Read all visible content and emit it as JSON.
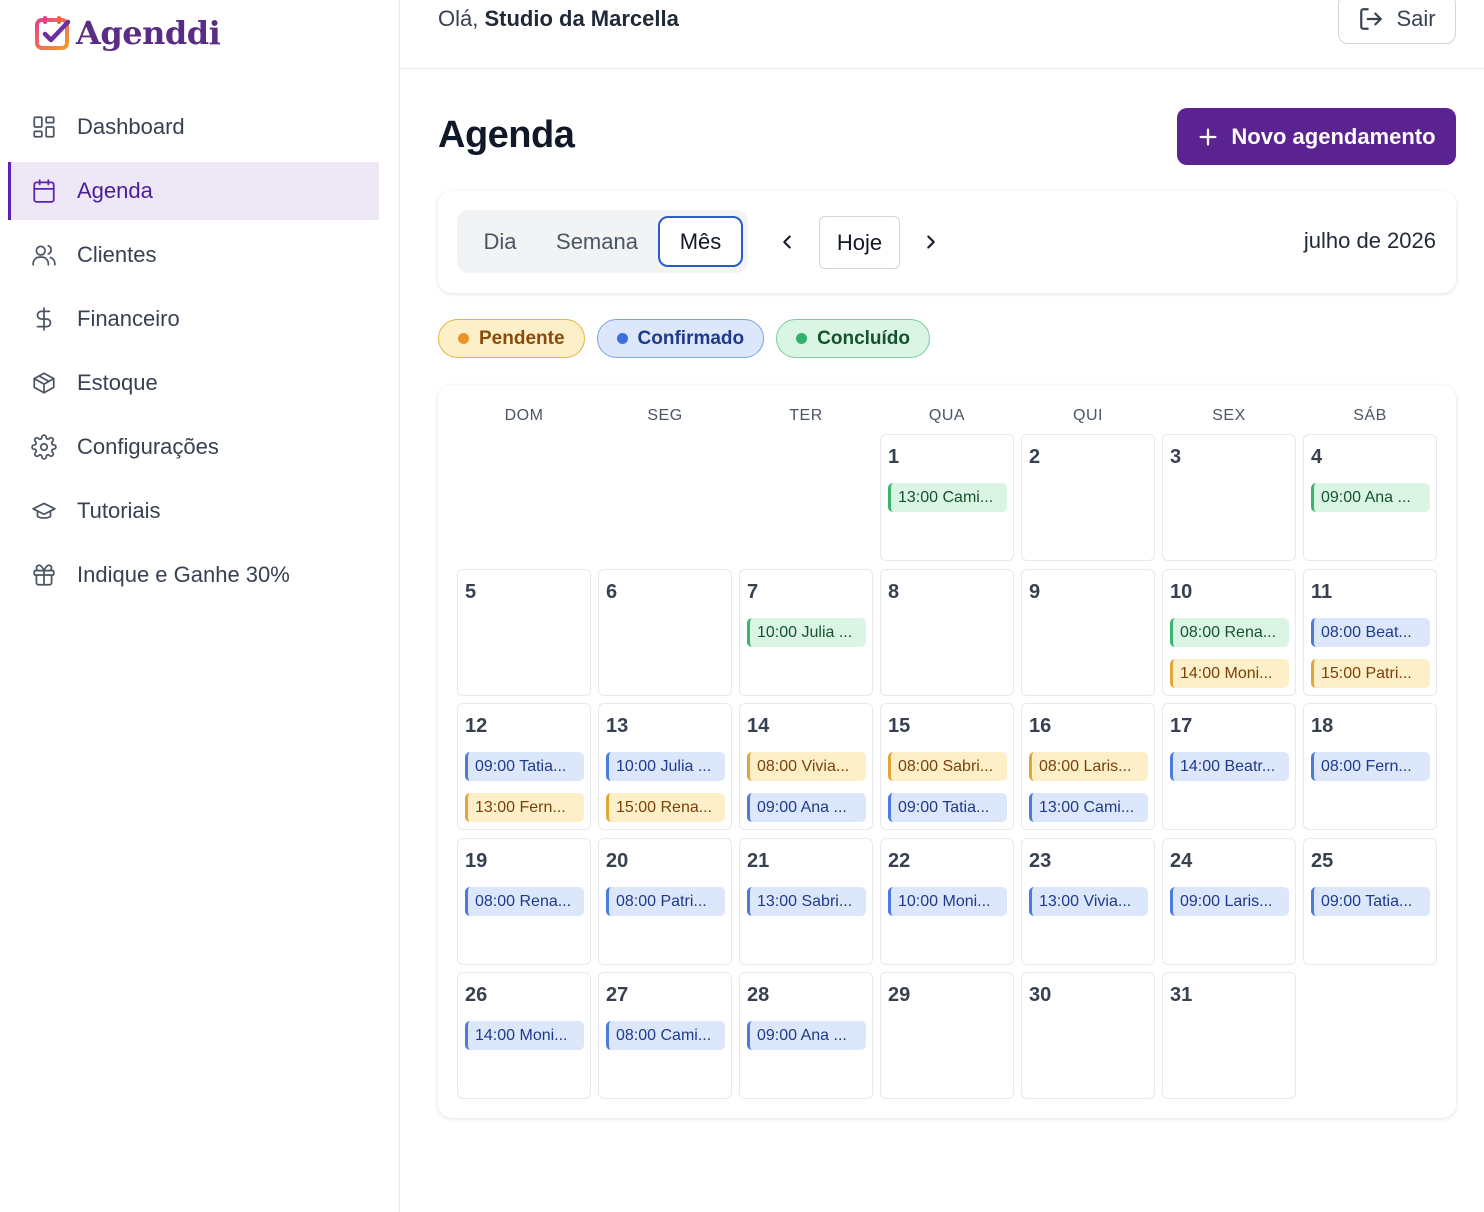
{
  "brand": {
    "name": "Agenddi"
  },
  "sidebar": {
    "items": [
      {
        "label": "Dashboard",
        "icon": "dashboard-icon",
        "active": false
      },
      {
        "label": "Agenda",
        "icon": "calendar-icon",
        "active": true
      },
      {
        "label": "Clientes",
        "icon": "users-icon",
        "active": false
      },
      {
        "label": "Financeiro",
        "icon": "dollar-icon",
        "active": false
      },
      {
        "label": "Estoque",
        "icon": "box-icon",
        "active": false
      },
      {
        "label": "Configurações",
        "icon": "gear-icon",
        "active": false
      },
      {
        "label": "Tutoriais",
        "icon": "graduation-cap-icon",
        "active": false
      },
      {
        "label": "Indique e Ganhe 30%",
        "icon": "gift-icon",
        "active": false
      }
    ]
  },
  "header": {
    "greeting_prefix": "Olá,",
    "user_name": "Studio da Marcella",
    "logout_label": "Sair"
  },
  "page": {
    "title": "Agenda",
    "new_button_label": "Novo agendamento"
  },
  "toolbar": {
    "views": [
      "Dia",
      "Semana",
      "Mês"
    ],
    "active_view": "Mês",
    "today_label": "Hoje",
    "month_label": "julho de 2026"
  },
  "legend": [
    {
      "label": "Pendente",
      "status": "pendente",
      "color": "#e8952a"
    },
    {
      "label": "Confirmado",
      "status": "confirmado",
      "color": "#3b6fe0"
    },
    {
      "label": "Concluído",
      "status": "concluido",
      "color": "#2fb36a"
    }
  ],
  "calendar": {
    "weekdays": [
      "DOM",
      "SEG",
      "TER",
      "QUA",
      "QUI",
      "SEX",
      "SÁB"
    ],
    "first_weekday_index": 3,
    "days_in_month": 31,
    "events": {
      "1": [
        {
          "text": "13:00 Cami...",
          "status": "concluido"
        }
      ],
      "4": [
        {
          "text": "09:00 Ana ...",
          "status": "concluido"
        }
      ],
      "7": [
        {
          "text": "10:00 Julia ...",
          "status": "concluido"
        }
      ],
      "10": [
        {
          "text": "08:00 Rena...",
          "status": "concluido"
        },
        {
          "text": "14:00 Moni...",
          "status": "pendente"
        }
      ],
      "11": [
        {
          "text": "08:00 Beat...",
          "status": "confirmado"
        },
        {
          "text": "15:00 Patri...",
          "status": "pendente"
        }
      ],
      "12": [
        {
          "text": "09:00 Tatia...",
          "status": "confirmado"
        },
        {
          "text": "13:00 Fern...",
          "status": "pendente"
        }
      ],
      "13": [
        {
          "text": "10:00 Julia ...",
          "status": "confirmado"
        },
        {
          "text": "15:00 Rena...",
          "status": "pendente"
        }
      ],
      "14": [
        {
          "text": "08:00 Vivia...",
          "status": "pendente"
        },
        {
          "text": "09:00 Ana ...",
          "status": "confirmado"
        }
      ],
      "15": [
        {
          "text": "08:00 Sabri...",
          "status": "pendente"
        },
        {
          "text": "09:00 Tatia...",
          "status": "confirmado"
        }
      ],
      "16": [
        {
          "text": "08:00 Laris...",
          "status": "pendente"
        },
        {
          "text": "13:00 Cami...",
          "status": "confirmado"
        }
      ],
      "17": [
        {
          "text": "14:00 Beatr...",
          "status": "confirmado"
        }
      ],
      "18": [
        {
          "text": "08:00 Fern...",
          "status": "confirmado"
        }
      ],
      "19": [
        {
          "text": "08:00 Rena...",
          "status": "confirmado"
        }
      ],
      "20": [
        {
          "text": "08:00 Patri...",
          "status": "confirmado"
        }
      ],
      "21": [
        {
          "text": "13:00 Sabri...",
          "status": "confirmado"
        }
      ],
      "22": [
        {
          "text": "10:00 Moni...",
          "status": "confirmado"
        }
      ],
      "23": [
        {
          "text": "13:00 Vivia...",
          "status": "confirmado"
        }
      ],
      "24": [
        {
          "text": "09:00 Laris...",
          "status": "confirmado"
        }
      ],
      "25": [
        {
          "text": "09:00 Tatia...",
          "status": "confirmado"
        }
      ],
      "26": [
        {
          "text": "14:00 Moni...",
          "status": "confirmado"
        }
      ],
      "27": [
        {
          "text": "08:00 Cami...",
          "status": "confirmado"
        }
      ],
      "28": [
        {
          "text": "09:00 Ana ...",
          "status": "confirmado"
        }
      ]
    }
  }
}
